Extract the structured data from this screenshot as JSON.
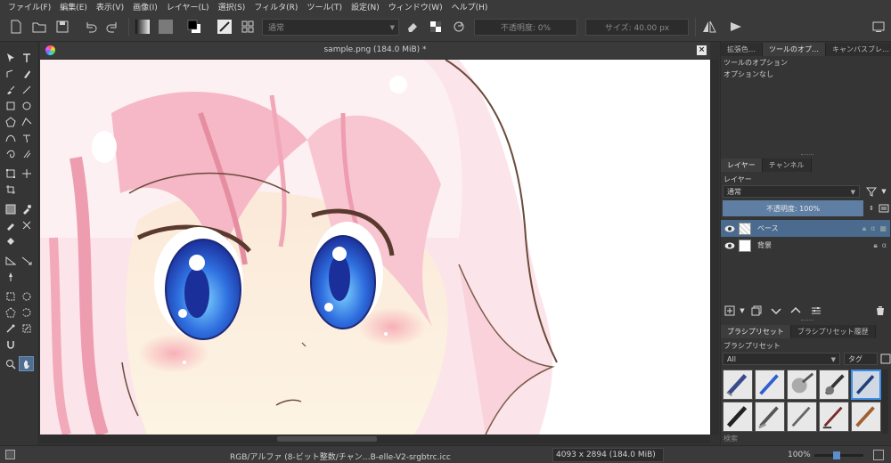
{
  "menu": [
    "ファイル(F)",
    "編集(E)",
    "表示(V)",
    "画像(I)",
    "レイヤー(L)",
    "選択(S)",
    "フィルタ(R)",
    "ツール(T)",
    "設定(N)",
    "ウィンドウ(W)",
    "ヘルプ(H)"
  ],
  "toolbar": {
    "blend_mode": "通常",
    "opacity": "不透明度: 0%",
    "size": "サイズ: 40.00 px"
  },
  "document": {
    "title": "sample.png (184.0 MiB) *"
  },
  "dock": {
    "top_tabs": [
      "拡張色…",
      "ツールのオプ…",
      "キャンバスブレ…"
    ],
    "tool_options_title": "ツールのオプション",
    "tool_options_empty": "オプションなし",
    "layer_tabs": [
      "レイヤー",
      "チャンネル"
    ],
    "layers_title": "レイヤー",
    "layer_blend": "通常",
    "layer_opacity": "不透明度: 100%",
    "layers": [
      {
        "name": "ベース",
        "selected": true
      },
      {
        "name": "背景",
        "selected": false
      }
    ],
    "brush_tabs": [
      "ブラシプリセット",
      "ブラシプリセット履歴"
    ],
    "brush_title": "ブラシプリセット",
    "brush_filter": "All",
    "brush_tag": "タグ",
    "brush_search": "検索"
  },
  "status": {
    "color_profile": "RGB/アルファ (8-ビット整数/チャン…B-elle-V2-srgbtrc.icc",
    "dimensions": "4093 x 2894 (184.0 MiB)",
    "zoom": "100%",
    "zoom_level": 0.45
  }
}
